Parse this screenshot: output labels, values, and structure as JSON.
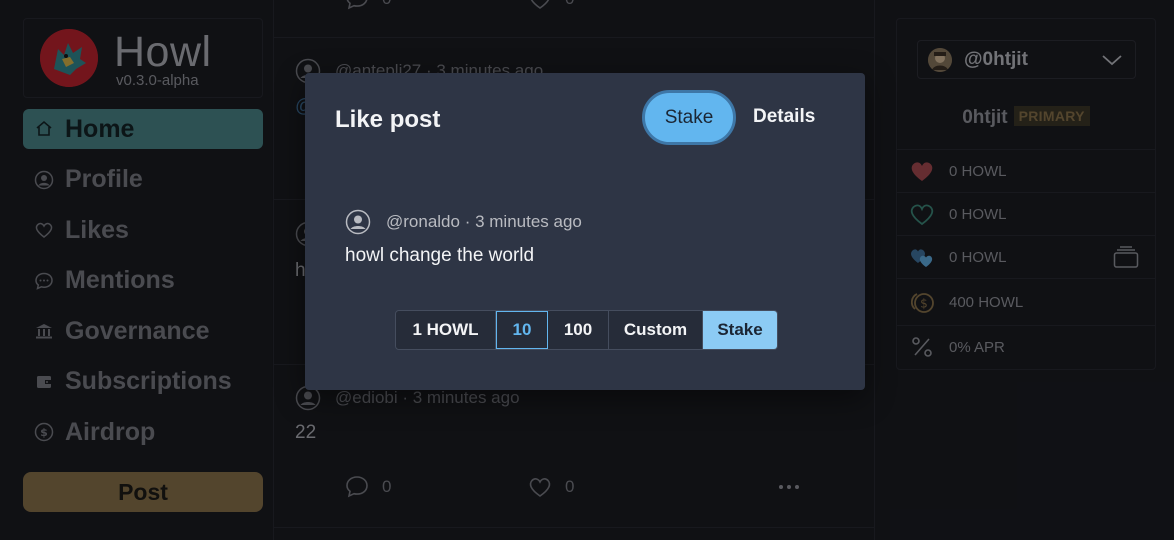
{
  "app": {
    "name": "Howl",
    "version": "v0.3.0-alpha"
  },
  "nav": {
    "items": [
      {
        "label": "Home",
        "icon": "home-icon"
      },
      {
        "label": "Profile",
        "icon": "profile-icon"
      },
      {
        "label": "Likes",
        "icon": "heart-icon"
      },
      {
        "label": "Mentions",
        "icon": "chat-icon"
      },
      {
        "label": "Governance",
        "icon": "bank-icon"
      },
      {
        "label": "Subscriptions",
        "icon": "wallet-icon"
      },
      {
        "label": "Airdrop",
        "icon": "coin-icon"
      }
    ],
    "post_label": "Post"
  },
  "feed": {
    "top": {
      "comments": "0",
      "likes": "0"
    },
    "post1": {
      "handle": "@antepli27 · 3 minutes ago",
      "body": "@"
    },
    "post2": {
      "body": "h"
    },
    "post3": {
      "handle": "@ediobi · 3 minutes ago",
      "body": "22",
      "comments": "0",
      "likes": "0"
    }
  },
  "account": {
    "handle": "@0htjit",
    "name": "0htjit",
    "badge": "PRIMARY",
    "stats": [
      {
        "icon": "heart-filled-icon",
        "value": "0 HOWL"
      },
      {
        "icon": "heart-outline-icon",
        "value": "0 HOWL"
      },
      {
        "icon": "hearts-icon",
        "value": "0 HOWL"
      },
      {
        "icon": "coins-icon",
        "value": "400 HOWL"
      },
      {
        "icon": "percent-icon",
        "value": "0% APR"
      }
    ]
  },
  "modal": {
    "title": "Like post",
    "tabs": {
      "stake": "Stake",
      "details": "Details"
    },
    "post": {
      "handle": "@ronaldo · 3 minutes ago",
      "body": "howl change the world"
    },
    "amounts": [
      "1 HOWL",
      "10",
      "100",
      "Custom"
    ],
    "selected_amount": "10",
    "submit_label": "Stake"
  },
  "colors": {
    "accent": "#62b6ef",
    "home_active": "#4a8b8d",
    "post_button": "#8f7548",
    "modal_bg": "#2e3545"
  }
}
